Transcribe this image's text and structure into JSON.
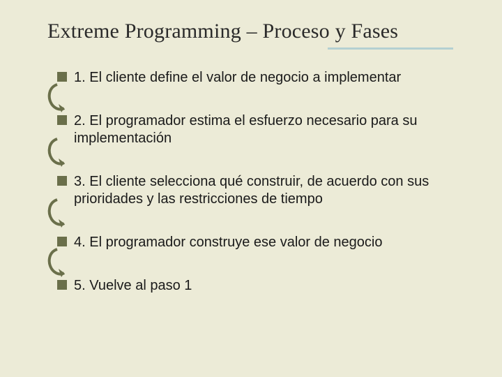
{
  "title": "Extreme Programming – Proceso y Fases",
  "items": [
    {
      "text": "1. El cliente define el valor de negocio a implementar"
    },
    {
      "text": "2. El programador estima el esfuerzo necesario para su implementación"
    },
    {
      "text": "3. El cliente selecciona qué construir, de acuerdo con sus prioridades y las restricciones de tiempo"
    },
    {
      "text": "4. El programador construye ese valor de negocio"
    },
    {
      "text": "5. Vuelve al paso 1"
    }
  ]
}
